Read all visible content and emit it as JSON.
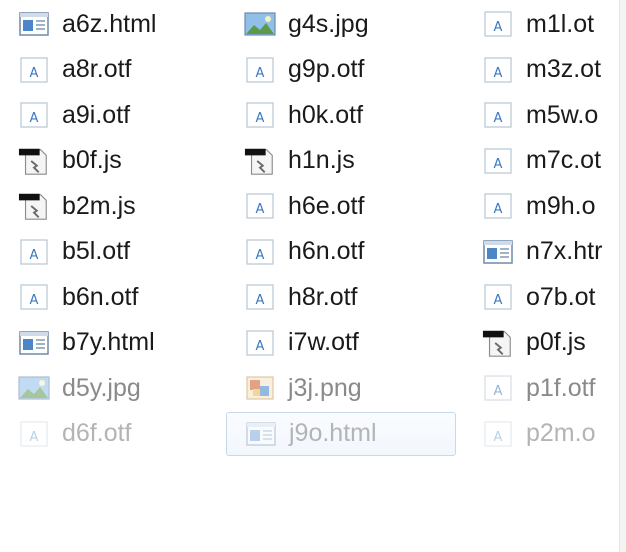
{
  "file_list": {
    "columns": [
      {
        "items": [
          {
            "name": "a6z.html",
            "icon": "html-file-icon",
            "state": "normal"
          },
          {
            "name": "a8r.otf",
            "icon": "font-file-icon",
            "state": "normal"
          },
          {
            "name": "a9i.otf",
            "icon": "font-file-icon",
            "state": "normal"
          },
          {
            "name": "b0f.js",
            "icon": "script-file-icon",
            "state": "normal"
          },
          {
            "name": "b2m.js",
            "icon": "script-file-icon",
            "state": "normal"
          },
          {
            "name": "b5l.otf",
            "icon": "font-file-icon",
            "state": "normal"
          },
          {
            "name": "b6n.otf",
            "icon": "font-file-icon",
            "state": "normal"
          },
          {
            "name": "b7y.html",
            "icon": "html-file-icon",
            "state": "normal"
          },
          {
            "name": "d5y.jpg",
            "icon": "image-file-icon",
            "state": "dim"
          },
          {
            "name": "d6f.otf",
            "icon": "font-file-icon",
            "state": "dimmer"
          }
        ]
      },
      {
        "items": [
          {
            "name": "g4s.jpg",
            "icon": "image-file-icon",
            "state": "normal"
          },
          {
            "name": "g9p.otf",
            "icon": "font-file-icon",
            "state": "normal"
          },
          {
            "name": "h0k.otf",
            "icon": "font-file-icon",
            "state": "normal"
          },
          {
            "name": "h1n.js",
            "icon": "script-file-icon",
            "state": "normal"
          },
          {
            "name": "h6e.otf",
            "icon": "font-file-icon",
            "state": "normal"
          },
          {
            "name": "h6n.otf",
            "icon": "font-file-icon",
            "state": "normal"
          },
          {
            "name": "h8r.otf",
            "icon": "font-file-icon",
            "state": "normal"
          },
          {
            "name": "i7w.otf",
            "icon": "font-file-icon",
            "state": "normal"
          },
          {
            "name": "j3j.png",
            "icon": "png-file-icon",
            "state": "dim"
          },
          {
            "name": "j9o.html",
            "icon": "html-file-icon",
            "state": "dimmer-hover"
          }
        ]
      },
      {
        "items": [
          {
            "name": "m1l.ot",
            "icon": "font-file-icon",
            "state": "normal"
          },
          {
            "name": "m3z.ot",
            "icon": "font-file-icon",
            "state": "normal"
          },
          {
            "name": "m5w.o",
            "icon": "font-file-icon",
            "state": "normal"
          },
          {
            "name": "m7c.ot",
            "icon": "font-file-icon",
            "state": "normal"
          },
          {
            "name": "m9h.o",
            "icon": "font-file-icon",
            "state": "normal"
          },
          {
            "name": "n7x.htr",
            "icon": "html-file-icon",
            "state": "normal"
          },
          {
            "name": "o7b.ot",
            "icon": "font-file-icon",
            "state": "normal"
          },
          {
            "name": "p0f.js",
            "icon": "script-file-icon",
            "state": "normal"
          },
          {
            "name": "p1f.otf",
            "icon": "font-file-icon",
            "state": "dim"
          },
          {
            "name": "p2m.o",
            "icon": "font-file-icon",
            "state": "dimmer"
          }
        ]
      }
    ]
  },
  "colors": {
    "html_icon_frame": "#6f8aa8",
    "html_icon_accent": "#4a86c8",
    "font_icon_letter": "#3a78c0",
    "script_icon_bar": "#111111",
    "image_icon_sky": "#8fc0e8",
    "image_icon_land": "#5c9a4a"
  }
}
